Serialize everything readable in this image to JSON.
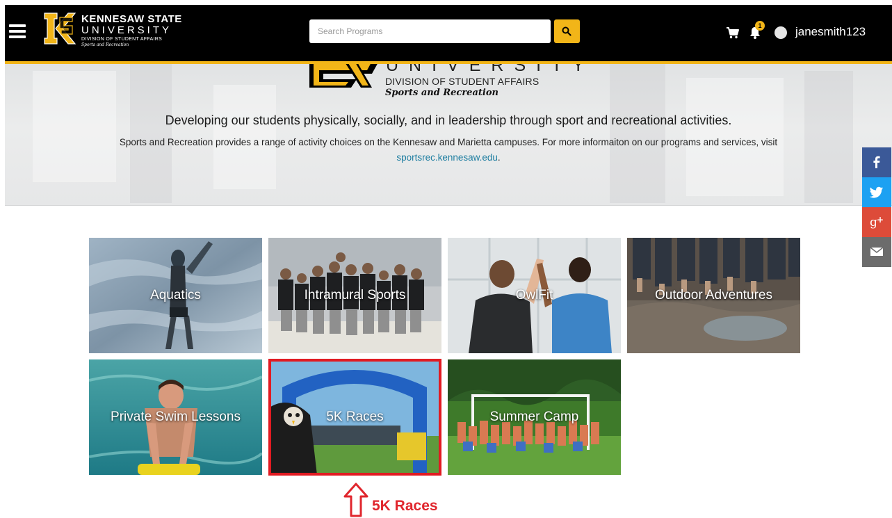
{
  "header": {
    "logo_line1": "KENNESAW STATE",
    "logo_line2": "UNIVERSITY",
    "logo_line3": "DIVISION OF STUDENT AFFAIRS",
    "logo_line4": "Sports and Recreation",
    "search_placeholder": "Search Programs",
    "notification_count": "1",
    "username": "janesmith123",
    "brand_color": "#f2b518"
  },
  "hero": {
    "univ_text": "UNIVERSITY",
    "division": "DIVISION OF STUDENT AFFAIRS",
    "subtitle": "Sports and Recreation",
    "tagline": "Developing our students physically, socially, and in leadership through sport and recreational activities.",
    "description": "Sports and Recreation provides a range of activity choices on the Kennesaw and Marietta campuses. For more informaiton on our programs and services, visit",
    "link": "sportsrec.kennesaw.edu",
    "link_suffix": "."
  },
  "social": [
    {
      "name": "facebook-icon",
      "color": "#3b5998"
    },
    {
      "name": "twitter-icon",
      "color": "#1da1f2"
    },
    {
      "name": "google-plus-icon",
      "color": "#dd4b39"
    },
    {
      "name": "email-icon",
      "color": "#6c6c6c"
    }
  ],
  "programs": [
    {
      "label": "Aquatics"
    },
    {
      "label": "Intramural Sports"
    },
    {
      "label": "OwlFit"
    },
    {
      "label": "Outdoor Adventures"
    },
    {
      "label": "Private Swim Lessons"
    },
    {
      "label": "5K Races"
    },
    {
      "label": "Summer Camp"
    }
  ],
  "annotation": {
    "label": "5K Races",
    "color": "#e0262d"
  }
}
